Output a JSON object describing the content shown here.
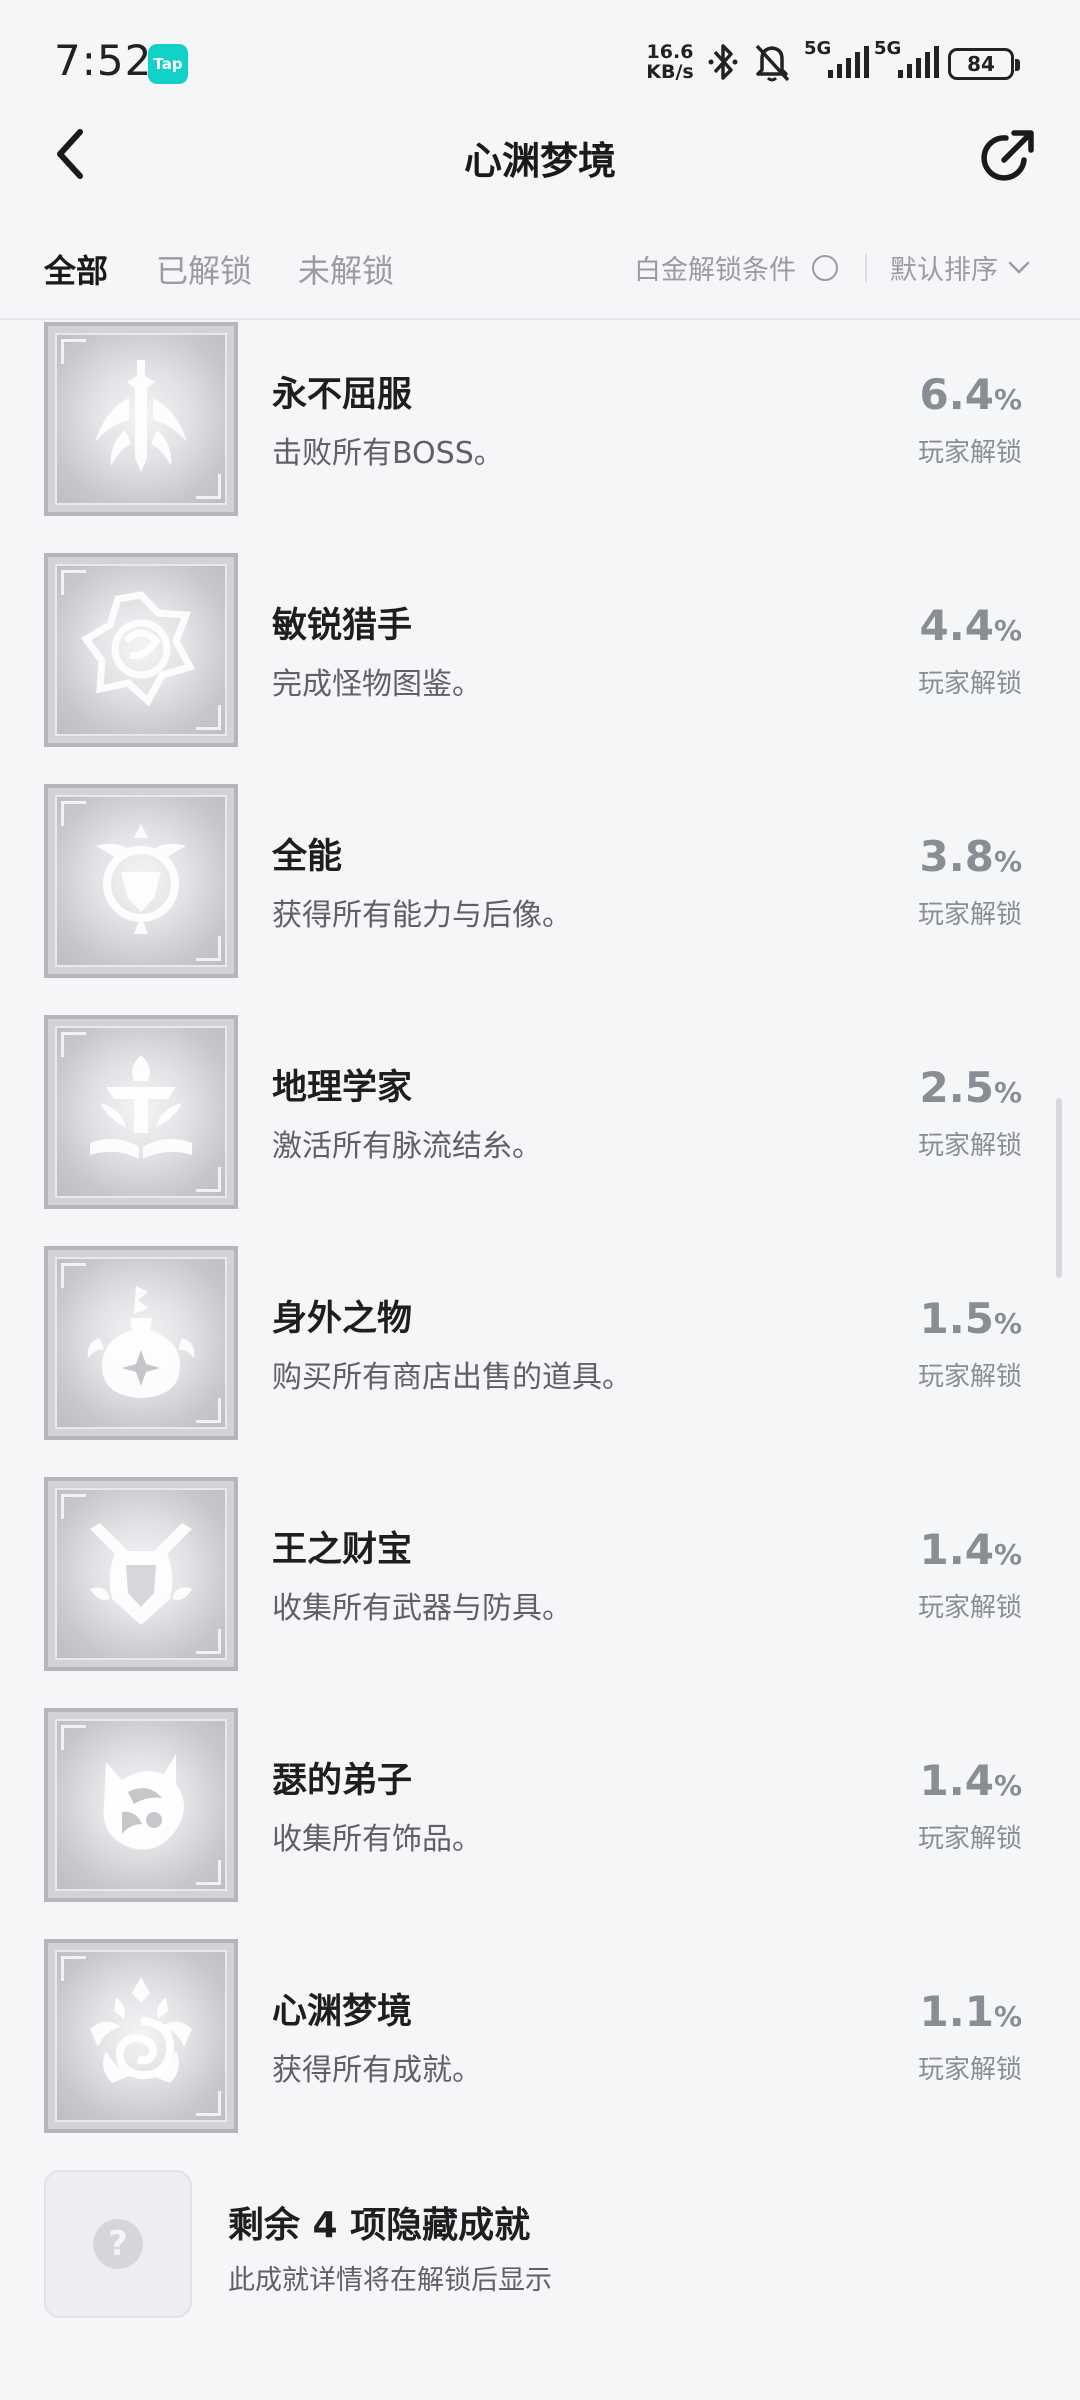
{
  "status_bar": {
    "time": "7:52",
    "app_badge": "Tap",
    "net_speed_value": "16.6",
    "net_speed_unit": "KB/s",
    "sim1": "5G",
    "sim2": "5G",
    "battery": "84",
    "icons": [
      "bluetooth-icon",
      "bell-muted-icon",
      "signal-icon",
      "signal-icon",
      "battery-icon"
    ]
  },
  "nav": {
    "title": "心渊梦境",
    "back_icon": "chevron-left-icon",
    "share_icon": "share-icon"
  },
  "filters": {
    "tabs": [
      {
        "label": "全部",
        "active": true
      },
      {
        "label": "已解锁",
        "active": false
      },
      {
        "label": "未解锁",
        "active": false
      }
    ],
    "platinum_label": "白金解锁条件",
    "sort_label": "默认排序"
  },
  "achievements": [
    {
      "name": "永不屈服",
      "desc": "击败所有BOSS。",
      "pct": "6.4",
      "unit": "%",
      "pct_label": "玩家解锁"
    },
    {
      "name": "敏锐猎手",
      "desc": "完成怪物图鉴。",
      "pct": "4.4",
      "unit": "%",
      "pct_label": "玩家解锁"
    },
    {
      "name": "全能",
      "desc": "获得所有能力与后像。",
      "pct": "3.8",
      "unit": "%",
      "pct_label": "玩家解锁"
    },
    {
      "name": "地理学家",
      "desc": "激活所有脉流结糸。",
      "pct": "2.5",
      "unit": "%",
      "pct_label": "玩家解锁"
    },
    {
      "name": "身外之物",
      "desc": "购买所有商店出售的道具。",
      "pct": "1.5",
      "unit": "%",
      "pct_label": "玩家解锁"
    },
    {
      "name": "王之财宝",
      "desc": "收集所有武器与防具。",
      "pct": "1.4",
      "unit": "%",
      "pct_label": "玩家解锁"
    },
    {
      "name": "瑟的弟子",
      "desc": "收集所有饰品。",
      "pct": "1.4",
      "unit": "%",
      "pct_label": "玩家解锁"
    },
    {
      "name": "心渊梦境",
      "desc": "获得所有成就。",
      "pct": "1.1",
      "unit": "%",
      "pct_label": "玩家解锁"
    }
  ],
  "hidden": {
    "title": "剩余 4 项隐藏成就",
    "desc": "此成就详情将在解锁后显示",
    "icon_glyph": "?"
  }
}
